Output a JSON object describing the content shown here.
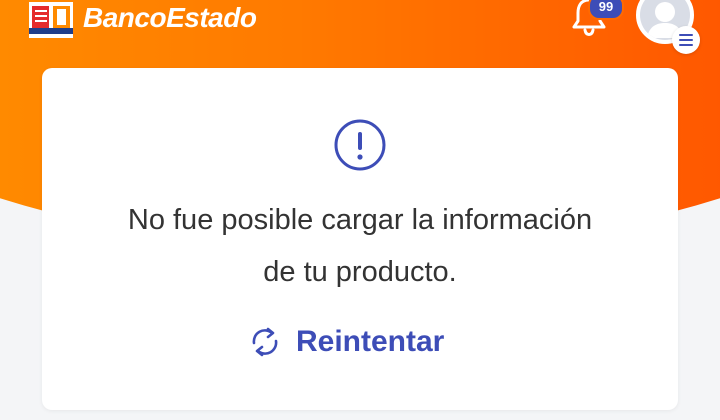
{
  "header": {
    "brand_name": "BancoEstado",
    "notification_count": "99",
    "logo_icon": "bancoestado-logo-icon",
    "bell_icon": "bell-icon",
    "avatar_icon": "user-avatar-icon",
    "menu_icon": "hamburger-menu-icon"
  },
  "card": {
    "alert_icon": "exclamation-circle-icon",
    "message_line1": "No fue posible cargar la información",
    "message_line2": "de tu producto.",
    "retry_label": "Reintentar",
    "retry_icon": "refresh-icon"
  },
  "colors": {
    "orange_start": "#ff9a00",
    "orange_end": "#ff4a00",
    "accent_blue": "#3d4db7",
    "text_dark": "#333333",
    "background": "#f4f5f7"
  }
}
